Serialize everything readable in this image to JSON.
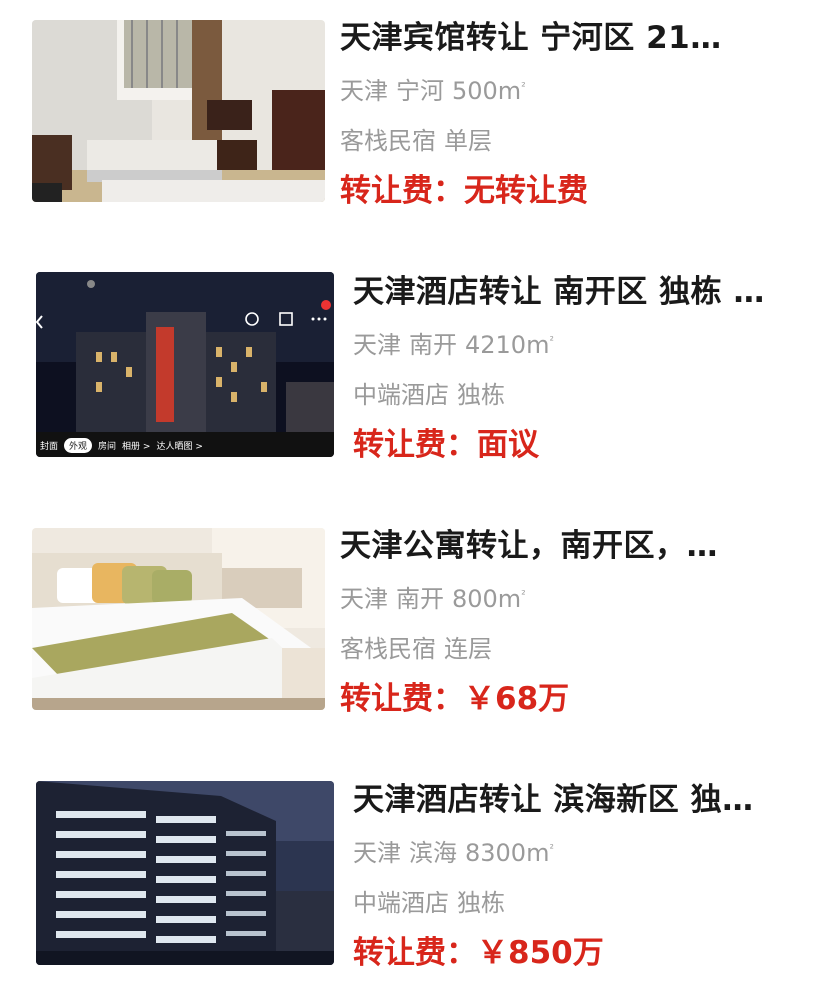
{
  "listings": [
    {
      "title": "天津宾馆转让 宁河区 21…",
      "city": "天津",
      "district": "宁河",
      "area": "500m",
      "area_unit_sup": "²",
      "tags": [
        "客栈民宿",
        "单层"
      ],
      "fee_label": "转让费：",
      "fee_value": "无转让费",
      "image": "hotel-room-twin-beds"
    },
    {
      "title": "天津酒店转让 南开区 独栋 …",
      "city": "天津",
      "district": "南开",
      "area": "4210m",
      "area_unit_sup": "²",
      "tags": [
        "中端酒店",
        "独栋"
      ],
      "fee_label": "转让费：",
      "fee_value": "面议",
      "image": "hotel-building-night",
      "image_overlay": {
        "tabs": [
          "封面",
          "外观",
          "房间",
          "相册 >",
          "达人晒图 >"
        ],
        "active_tab": "外观"
      }
    },
    {
      "title": "天津公寓转让，南开区，…",
      "city": "天津",
      "district": "南开",
      "area": "800m",
      "area_unit_sup": "²",
      "tags": [
        "客栈民宿",
        "连层"
      ],
      "fee_label": "转让费：",
      "fee_value": "￥68万",
      "image": "apartment-bedroom"
    },
    {
      "title": "天津酒店转让 滨海新区 独…",
      "city": "天津",
      "district": "滨海",
      "area": "8300m",
      "area_unit_sup": "²",
      "tags": [
        "中端酒店",
        "独栋"
      ],
      "fee_label": "转让费：",
      "fee_value": "￥850万",
      "image": "office-tower-dusk"
    }
  ],
  "colors": {
    "title": "#1a1a1a",
    "meta": "#9a9a9a",
    "price": "#d8261b"
  }
}
